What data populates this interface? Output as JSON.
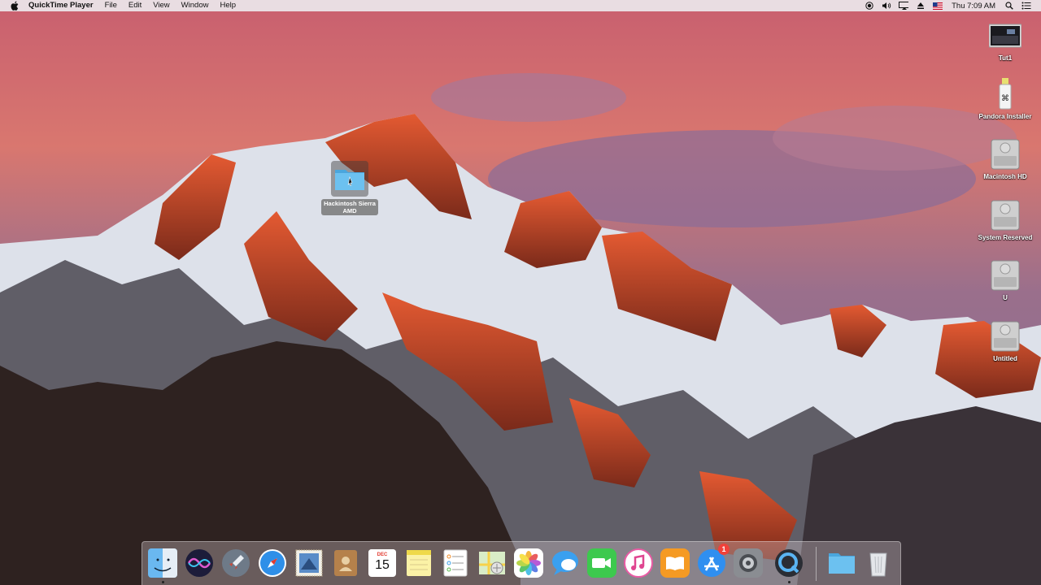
{
  "menubar": {
    "app_name": "QuickTime Player",
    "menus": [
      "File",
      "Edit",
      "View",
      "Window",
      "Help"
    ],
    "clock": "Thu 7:09 AM"
  },
  "desktop": {
    "selected_folder": {
      "label_line1": "Hackintosh Sierra",
      "label_line2": "AMD"
    },
    "icons": [
      {
        "label": "Tut1",
        "icon": "screenshot-thumbnail-icon"
      },
      {
        "label": "Pandora Installer",
        "icon": "usb-drive-icon"
      },
      {
        "label": "Macintosh HD",
        "icon": "hard-disk-icon"
      },
      {
        "label": "System Reserved",
        "icon": "hard-disk-icon"
      },
      {
        "label": "U",
        "icon": "hard-disk-icon"
      },
      {
        "label": "Untitled",
        "icon": "hard-disk-icon"
      }
    ]
  },
  "dock": {
    "apps": [
      "Finder",
      "Siri",
      "Launchpad",
      "Safari",
      "Mail",
      "Contacts",
      "Calendar",
      "Notes",
      "Reminders",
      "Maps",
      "Photos",
      "Messages",
      "FaceTime",
      "iTunes",
      "iBooks",
      "App Store",
      "System Preferences",
      "QuickTime Player",
      "Downloads",
      "Trash"
    ],
    "calendar": {
      "month": "DEC",
      "day": "15"
    },
    "app_store_badge": "1"
  },
  "colors": {
    "menubar_bg": "#ebe8eb",
    "badge": "#f0413a",
    "folder_blue": "#5fb8ea"
  }
}
